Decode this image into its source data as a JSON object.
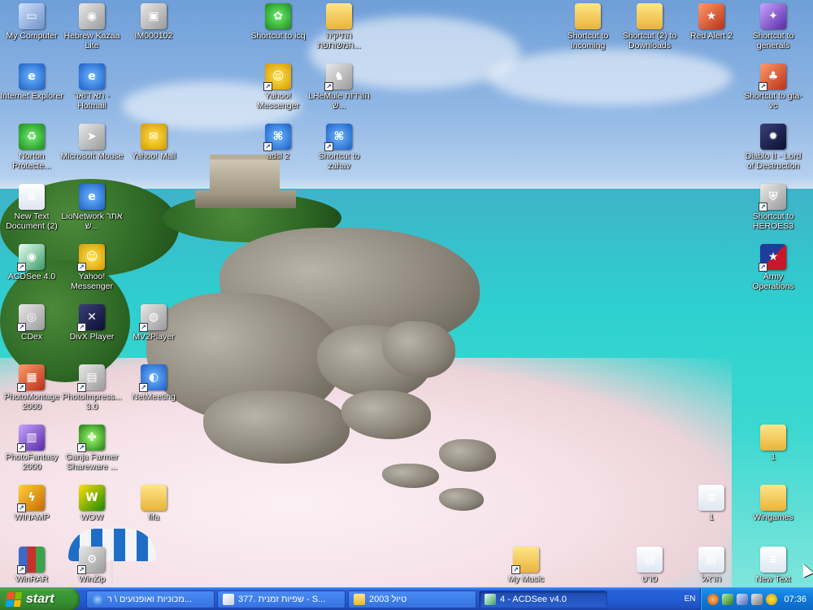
{
  "desktop": {
    "icons": [
      {
        "id": "my-computer",
        "label": "My Computer",
        "glyph": "computer-icon",
        "shortcut": false
      },
      {
        "id": "hebrew-kazaa",
        "label": "Hebrew Kazaa Lite",
        "glyph": "kazaa-icon",
        "shortcut": false
      },
      {
        "id": "im000102",
        "label": "IM000102",
        "glyph": "jpg-file-icon",
        "shortcut": false
      },
      {
        "id": "shortcut-icq",
        "label": "Shortcut to icq",
        "glyph": "icq-flower-icon",
        "shortcut": false
      },
      {
        "id": "folder-heb1",
        "label": "התיקיה המשותפת...",
        "glyph": "folder-icon",
        "shortcut": false
      },
      {
        "id": "shortcut-incoming",
        "label": "Shortcut to Incoming",
        "glyph": "folder-icon",
        "shortcut": false
      },
      {
        "id": "shortcut-downloads",
        "label": "Shortcut (2) to Downloads",
        "glyph": "folder-icon",
        "shortcut": false
      },
      {
        "id": "red-alert-2",
        "label": "Red Alert 2",
        "glyph": "game-icon",
        "shortcut": false
      },
      {
        "id": "shortcut-generals",
        "label": "Shortcut to generals",
        "glyph": "generals-icon",
        "shortcut": false
      },
      {
        "id": "internet-explorer",
        "label": "Internet Explorer",
        "glyph": "ie-icon",
        "shortcut": false
      },
      {
        "id": "hotmail",
        "label": "תא דואר - Hotmail",
        "glyph": "ie-icon",
        "shortcut": false
      },
      {
        "id": "yahoo-messenger-1",
        "label": "Yahoo! Messenger",
        "glyph": "yahoo-smiley-icon",
        "shortcut": true
      },
      {
        "id": "lhemule",
        "label": "LHeMule הורדות ש...",
        "glyph": "emule-icon",
        "shortcut": true
      },
      {
        "id": "shortcut-gta",
        "label": "Shortcut to gta-vc",
        "glyph": "gta-icon",
        "shortcut": true
      },
      {
        "id": "norton",
        "label": "Norton Protecte...",
        "glyph": "recycle-bin-icon",
        "shortcut": false
      },
      {
        "id": "microsoft-mouse",
        "label": "Microsoft Mouse",
        "glyph": "mouse-pointer-icon",
        "shortcut": false
      },
      {
        "id": "yahoo-mail",
        "label": "Yahoo! Mail",
        "glyph": "yahoo-mail-icon",
        "shortcut": false
      },
      {
        "id": "adsl2",
        "label": "adsl 2",
        "glyph": "network-icon",
        "shortcut": true
      },
      {
        "id": "shortcut-zahav",
        "label": "Shortcut to zahav",
        "glyph": "network-icon",
        "shortcut": true
      },
      {
        "id": "diablo2",
        "label": "Diablo II - Lord of Destruction",
        "glyph": "diablo-icon",
        "shortcut": false
      },
      {
        "id": "new-text-2",
        "label": "New Text Document (2)",
        "glyph": "text-document-icon",
        "shortcut": false
      },
      {
        "id": "lionetwork",
        "label": "LioNetwork אתר ש...",
        "glyph": "ie-icon",
        "shortcut": false
      },
      {
        "id": "shortcut-heroes3",
        "label": "Shortcut to HEROES3",
        "glyph": "heroes-icon",
        "shortcut": true
      },
      {
        "id": "acdsee",
        "label": "ACDSee 4.0",
        "glyph": "eye-icon",
        "shortcut": true
      },
      {
        "id": "yahoo-messenger-2",
        "label": "Yahoo! Messenger",
        "glyph": "yahoo-smiley-icon",
        "shortcut": true
      },
      {
        "id": "army-operations",
        "label": "Army Operations",
        "glyph": "army-star-icon",
        "shortcut": true
      },
      {
        "id": "cdex",
        "label": "CDex",
        "glyph": "cd-icon",
        "shortcut": true
      },
      {
        "id": "divx-player",
        "label": "DivX Player",
        "glyph": "divx-icon",
        "shortcut": true
      },
      {
        "id": "mv2player",
        "label": "MV2Player",
        "glyph": "media-player-icon",
        "shortcut": true
      },
      {
        "id": "photomontage",
        "label": "PhotoMontage 2000",
        "glyph": "photo-icon",
        "shortcut": true
      },
      {
        "id": "photoimpression",
        "label": "PhotoImpress... 3.0",
        "glyph": "photo-icon",
        "shortcut": true
      },
      {
        "id": "netmeeting",
        "label": "NetMeeting",
        "glyph": "netmeeting-icon",
        "shortcut": true
      },
      {
        "id": "photofantasy",
        "label": "PhotoFantasy 2000",
        "glyph": "photo-icon",
        "shortcut": true
      },
      {
        "id": "ganja-farmer",
        "label": "Ganja Farmer Shareware ...",
        "glyph": "leaf-icon",
        "shortcut": true
      },
      {
        "id": "folder-1",
        "label": "1",
        "glyph": "folder-icon",
        "shortcut": false
      },
      {
        "id": "winamp",
        "label": "WINAMP",
        "glyph": "winamp-icon",
        "shortcut": true
      },
      {
        "id": "wow",
        "label": "WOW",
        "glyph": "wow-icon",
        "shortcut": false
      },
      {
        "id": "folder-fifa",
        "label": "fifa",
        "glyph": "folder-icon",
        "shortcut": false
      },
      {
        "id": "doc-1",
        "label": "1",
        "glyph": "text-document-icon",
        "shortcut": false
      },
      {
        "id": "wingames",
        "label": "Wingames",
        "glyph": "folder-icon",
        "shortcut": false
      },
      {
        "id": "winrar",
        "label": "WinRAR",
        "glyph": "winrar-icon",
        "shortcut": true
      },
      {
        "id": "winzip",
        "label": "WinZip",
        "glyph": "winzip-icon",
        "shortcut": true
      },
      {
        "id": "my-music",
        "label": "My Music",
        "glyph": "folder-icon",
        "shortcut": true
      },
      {
        "id": "doc-heb1",
        "label": "סרט",
        "glyph": "document-icon",
        "shortcut": false
      },
      {
        "id": "doc-heb2",
        "label": "הראל",
        "glyph": "document-icon",
        "shortcut": false
      },
      {
        "id": "new-text",
        "label": "New Text",
        "glyph": "text-document-icon",
        "shortcut": false
      }
    ]
  },
  "taskbar": {
    "start_label": "start",
    "tasks": [
      {
        "label": "מכוניות ואופנועים \\ ר...",
        "icon": "ie-icon",
        "active": false
      },
      {
        "label": "377. שפיות זמנית - S...",
        "icon": "notepad-icon",
        "active": false
      },
      {
        "label": "טיול 2003",
        "icon": "folder-icon",
        "active": false
      },
      {
        "label": "4 - ACDSee v4.0",
        "icon": "eye-icon",
        "active": true
      }
    ],
    "language": "EN",
    "tray_icons": [
      "back-arrow-icon",
      "network-icon",
      "monitor-icon",
      "volume-icon",
      "yahoo-smiley-icon"
    ],
    "clock": "07:36"
  },
  "colors": {
    "taskbar": "#245ed5",
    "start": "#378f31",
    "tray": "#0f78d8"
  }
}
